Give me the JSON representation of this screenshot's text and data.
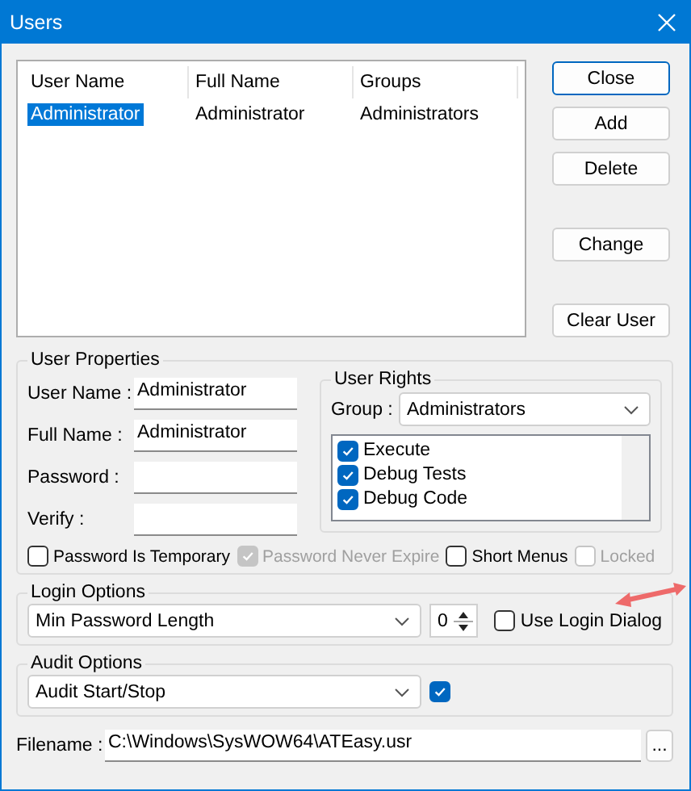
{
  "window": {
    "title": "Users"
  },
  "users_table": {
    "columns": [
      "User Name",
      "Full Name",
      "Groups"
    ],
    "rows": [
      {
        "cells": [
          "Administrator",
          "Administrator",
          "Administrators"
        ],
        "selected": true
      }
    ]
  },
  "button_groups": [
    [
      {
        "label": "Close",
        "focused": true
      },
      {
        "label": "Add",
        "focused": false
      },
      {
        "label": "Delete",
        "focused": false
      }
    ],
    [
      {
        "label": "Change",
        "focused": false
      }
    ],
    [
      {
        "label": "Clear User",
        "focused": false
      }
    ]
  ],
  "user_properties": {
    "title": "User Properties",
    "fields": [
      {
        "label": "User Name :",
        "value": "Administrator"
      },
      {
        "label": "Full Name :",
        "value": "Administrator"
      },
      {
        "label": "Password :"
      },
      {
        "label": "Verify :"
      }
    ],
    "user_rights": {
      "title": "User Rights",
      "group_label": "Group :",
      "group_value": "Administrators",
      "rights": [
        {
          "label": "Execute",
          "checked": true
        },
        {
          "label": "Debug Tests",
          "checked": true
        },
        {
          "label": "Debug Code",
          "checked": true
        }
      ]
    },
    "options": [
      {
        "label": "Password Is Temporary",
        "checked": false,
        "disabled": false
      },
      {
        "label": "Password Never Expire",
        "checked": true,
        "disabled": true
      },
      {
        "label": "Short Menus",
        "checked": false,
        "disabled": false
      },
      {
        "label": "Locked",
        "checked": false,
        "disabled": true
      }
    ]
  },
  "login_options": {
    "title": "Login Options",
    "setting": "Min Password Length",
    "value": "0",
    "use_login_dialog": {
      "label": "Use Login Dialog",
      "checked": false
    }
  },
  "audit_options": {
    "title": "Audit Options",
    "event": "Audit Start/Stop",
    "enabled": true
  },
  "filename": {
    "label": "Filename :",
    "value": "C:\\Windows\\SysWOW64\\ATEasy.usr",
    "browse": "..."
  }
}
